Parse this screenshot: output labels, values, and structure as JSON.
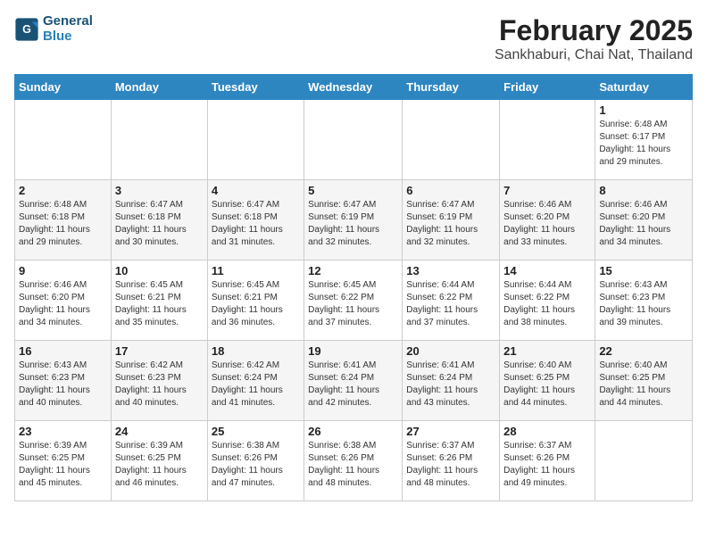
{
  "logo": {
    "line1": "General",
    "line2": "Blue"
  },
  "title": "February 2025",
  "subtitle": "Sankhaburi, Chai Nat, Thailand",
  "days_of_week": [
    "Sunday",
    "Monday",
    "Tuesday",
    "Wednesday",
    "Thursday",
    "Friday",
    "Saturday"
  ],
  "weeks": [
    [
      {
        "day": "",
        "info": ""
      },
      {
        "day": "",
        "info": ""
      },
      {
        "day": "",
        "info": ""
      },
      {
        "day": "",
        "info": ""
      },
      {
        "day": "",
        "info": ""
      },
      {
        "day": "",
        "info": ""
      },
      {
        "day": "1",
        "info": "Sunrise: 6:48 AM\nSunset: 6:17 PM\nDaylight: 11 hours\nand 29 minutes."
      }
    ],
    [
      {
        "day": "2",
        "info": "Sunrise: 6:48 AM\nSunset: 6:18 PM\nDaylight: 11 hours\nand 29 minutes."
      },
      {
        "day": "3",
        "info": "Sunrise: 6:47 AM\nSunset: 6:18 PM\nDaylight: 11 hours\nand 30 minutes."
      },
      {
        "day": "4",
        "info": "Sunrise: 6:47 AM\nSunset: 6:18 PM\nDaylight: 11 hours\nand 31 minutes."
      },
      {
        "day": "5",
        "info": "Sunrise: 6:47 AM\nSunset: 6:19 PM\nDaylight: 11 hours\nand 32 minutes."
      },
      {
        "day": "6",
        "info": "Sunrise: 6:47 AM\nSunset: 6:19 PM\nDaylight: 11 hours\nand 32 minutes."
      },
      {
        "day": "7",
        "info": "Sunrise: 6:46 AM\nSunset: 6:20 PM\nDaylight: 11 hours\nand 33 minutes."
      },
      {
        "day": "8",
        "info": "Sunrise: 6:46 AM\nSunset: 6:20 PM\nDaylight: 11 hours\nand 34 minutes."
      }
    ],
    [
      {
        "day": "9",
        "info": "Sunrise: 6:46 AM\nSunset: 6:20 PM\nDaylight: 11 hours\nand 34 minutes."
      },
      {
        "day": "10",
        "info": "Sunrise: 6:45 AM\nSunset: 6:21 PM\nDaylight: 11 hours\nand 35 minutes."
      },
      {
        "day": "11",
        "info": "Sunrise: 6:45 AM\nSunset: 6:21 PM\nDaylight: 11 hours\nand 36 minutes."
      },
      {
        "day": "12",
        "info": "Sunrise: 6:45 AM\nSunset: 6:22 PM\nDaylight: 11 hours\nand 37 minutes."
      },
      {
        "day": "13",
        "info": "Sunrise: 6:44 AM\nSunset: 6:22 PM\nDaylight: 11 hours\nand 37 minutes."
      },
      {
        "day": "14",
        "info": "Sunrise: 6:44 AM\nSunset: 6:22 PM\nDaylight: 11 hours\nand 38 minutes."
      },
      {
        "day": "15",
        "info": "Sunrise: 6:43 AM\nSunset: 6:23 PM\nDaylight: 11 hours\nand 39 minutes."
      }
    ],
    [
      {
        "day": "16",
        "info": "Sunrise: 6:43 AM\nSunset: 6:23 PM\nDaylight: 11 hours\nand 40 minutes."
      },
      {
        "day": "17",
        "info": "Sunrise: 6:42 AM\nSunset: 6:23 PM\nDaylight: 11 hours\nand 40 minutes."
      },
      {
        "day": "18",
        "info": "Sunrise: 6:42 AM\nSunset: 6:24 PM\nDaylight: 11 hours\nand 41 minutes."
      },
      {
        "day": "19",
        "info": "Sunrise: 6:41 AM\nSunset: 6:24 PM\nDaylight: 11 hours\nand 42 minutes."
      },
      {
        "day": "20",
        "info": "Sunrise: 6:41 AM\nSunset: 6:24 PM\nDaylight: 11 hours\nand 43 minutes."
      },
      {
        "day": "21",
        "info": "Sunrise: 6:40 AM\nSunset: 6:25 PM\nDaylight: 11 hours\nand 44 minutes."
      },
      {
        "day": "22",
        "info": "Sunrise: 6:40 AM\nSunset: 6:25 PM\nDaylight: 11 hours\nand 44 minutes."
      }
    ],
    [
      {
        "day": "23",
        "info": "Sunrise: 6:39 AM\nSunset: 6:25 PM\nDaylight: 11 hours\nand 45 minutes."
      },
      {
        "day": "24",
        "info": "Sunrise: 6:39 AM\nSunset: 6:25 PM\nDaylight: 11 hours\nand 46 minutes."
      },
      {
        "day": "25",
        "info": "Sunrise: 6:38 AM\nSunset: 6:26 PM\nDaylight: 11 hours\nand 47 minutes."
      },
      {
        "day": "26",
        "info": "Sunrise: 6:38 AM\nSunset: 6:26 PM\nDaylight: 11 hours\nand 48 minutes."
      },
      {
        "day": "27",
        "info": "Sunrise: 6:37 AM\nSunset: 6:26 PM\nDaylight: 11 hours\nand 48 minutes."
      },
      {
        "day": "28",
        "info": "Sunrise: 6:37 AM\nSunset: 6:26 PM\nDaylight: 11 hours\nand 49 minutes."
      },
      {
        "day": "",
        "info": ""
      }
    ]
  ]
}
